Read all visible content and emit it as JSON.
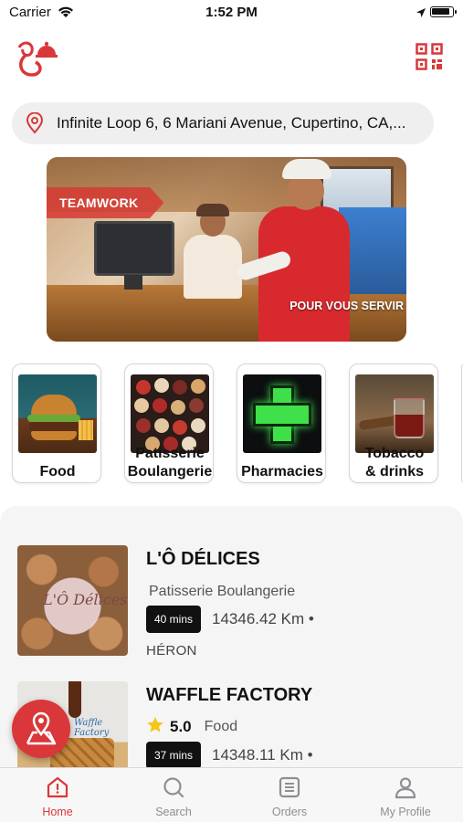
{
  "status_bar": {
    "carrier": "Carrier",
    "time": "1:52 PM"
  },
  "address": {
    "text": "Infinite Loop 6, 6 Mariani Avenue, Cupertino, CA,..."
  },
  "banner": {
    "badge": "TEAMWORK",
    "tagline": "POUR VOUS SERVIR"
  },
  "categories": [
    {
      "label": "Food",
      "icon": "burger-photo"
    },
    {
      "label_line1": "Patisserie",
      "label_line2": "Boulangerie",
      "icon": "pastry-photo"
    },
    {
      "label": "Pharmacies",
      "icon": "pharmacy-cross-photo"
    },
    {
      "label_line1": "Tobacco",
      "label_line2": "& drinks",
      "icon": "drinks-photo"
    }
  ],
  "shops": [
    {
      "name": "L'Ô DÉLICES",
      "category": "Patisserie Boulangerie",
      "time": "40 mins",
      "distance": "14346.42 Km •",
      "location": "HÉRON",
      "logo_text": "L'Ô Délices"
    },
    {
      "name": "WAFFLE FACTORY",
      "rating": "5.0",
      "category": "Food",
      "time": "37 mins",
      "distance": "14348.11 Km •",
      "logo_text": "Waffle Factory"
    }
  ],
  "tabbar": {
    "home": "Home",
    "search": "Search",
    "orders": "Orders",
    "profile": "My Profile"
  },
  "colors": {
    "accent": "#d9373a",
    "tab_inactive": "#8e8e93",
    "panel_bg": "#f5f5f5"
  }
}
